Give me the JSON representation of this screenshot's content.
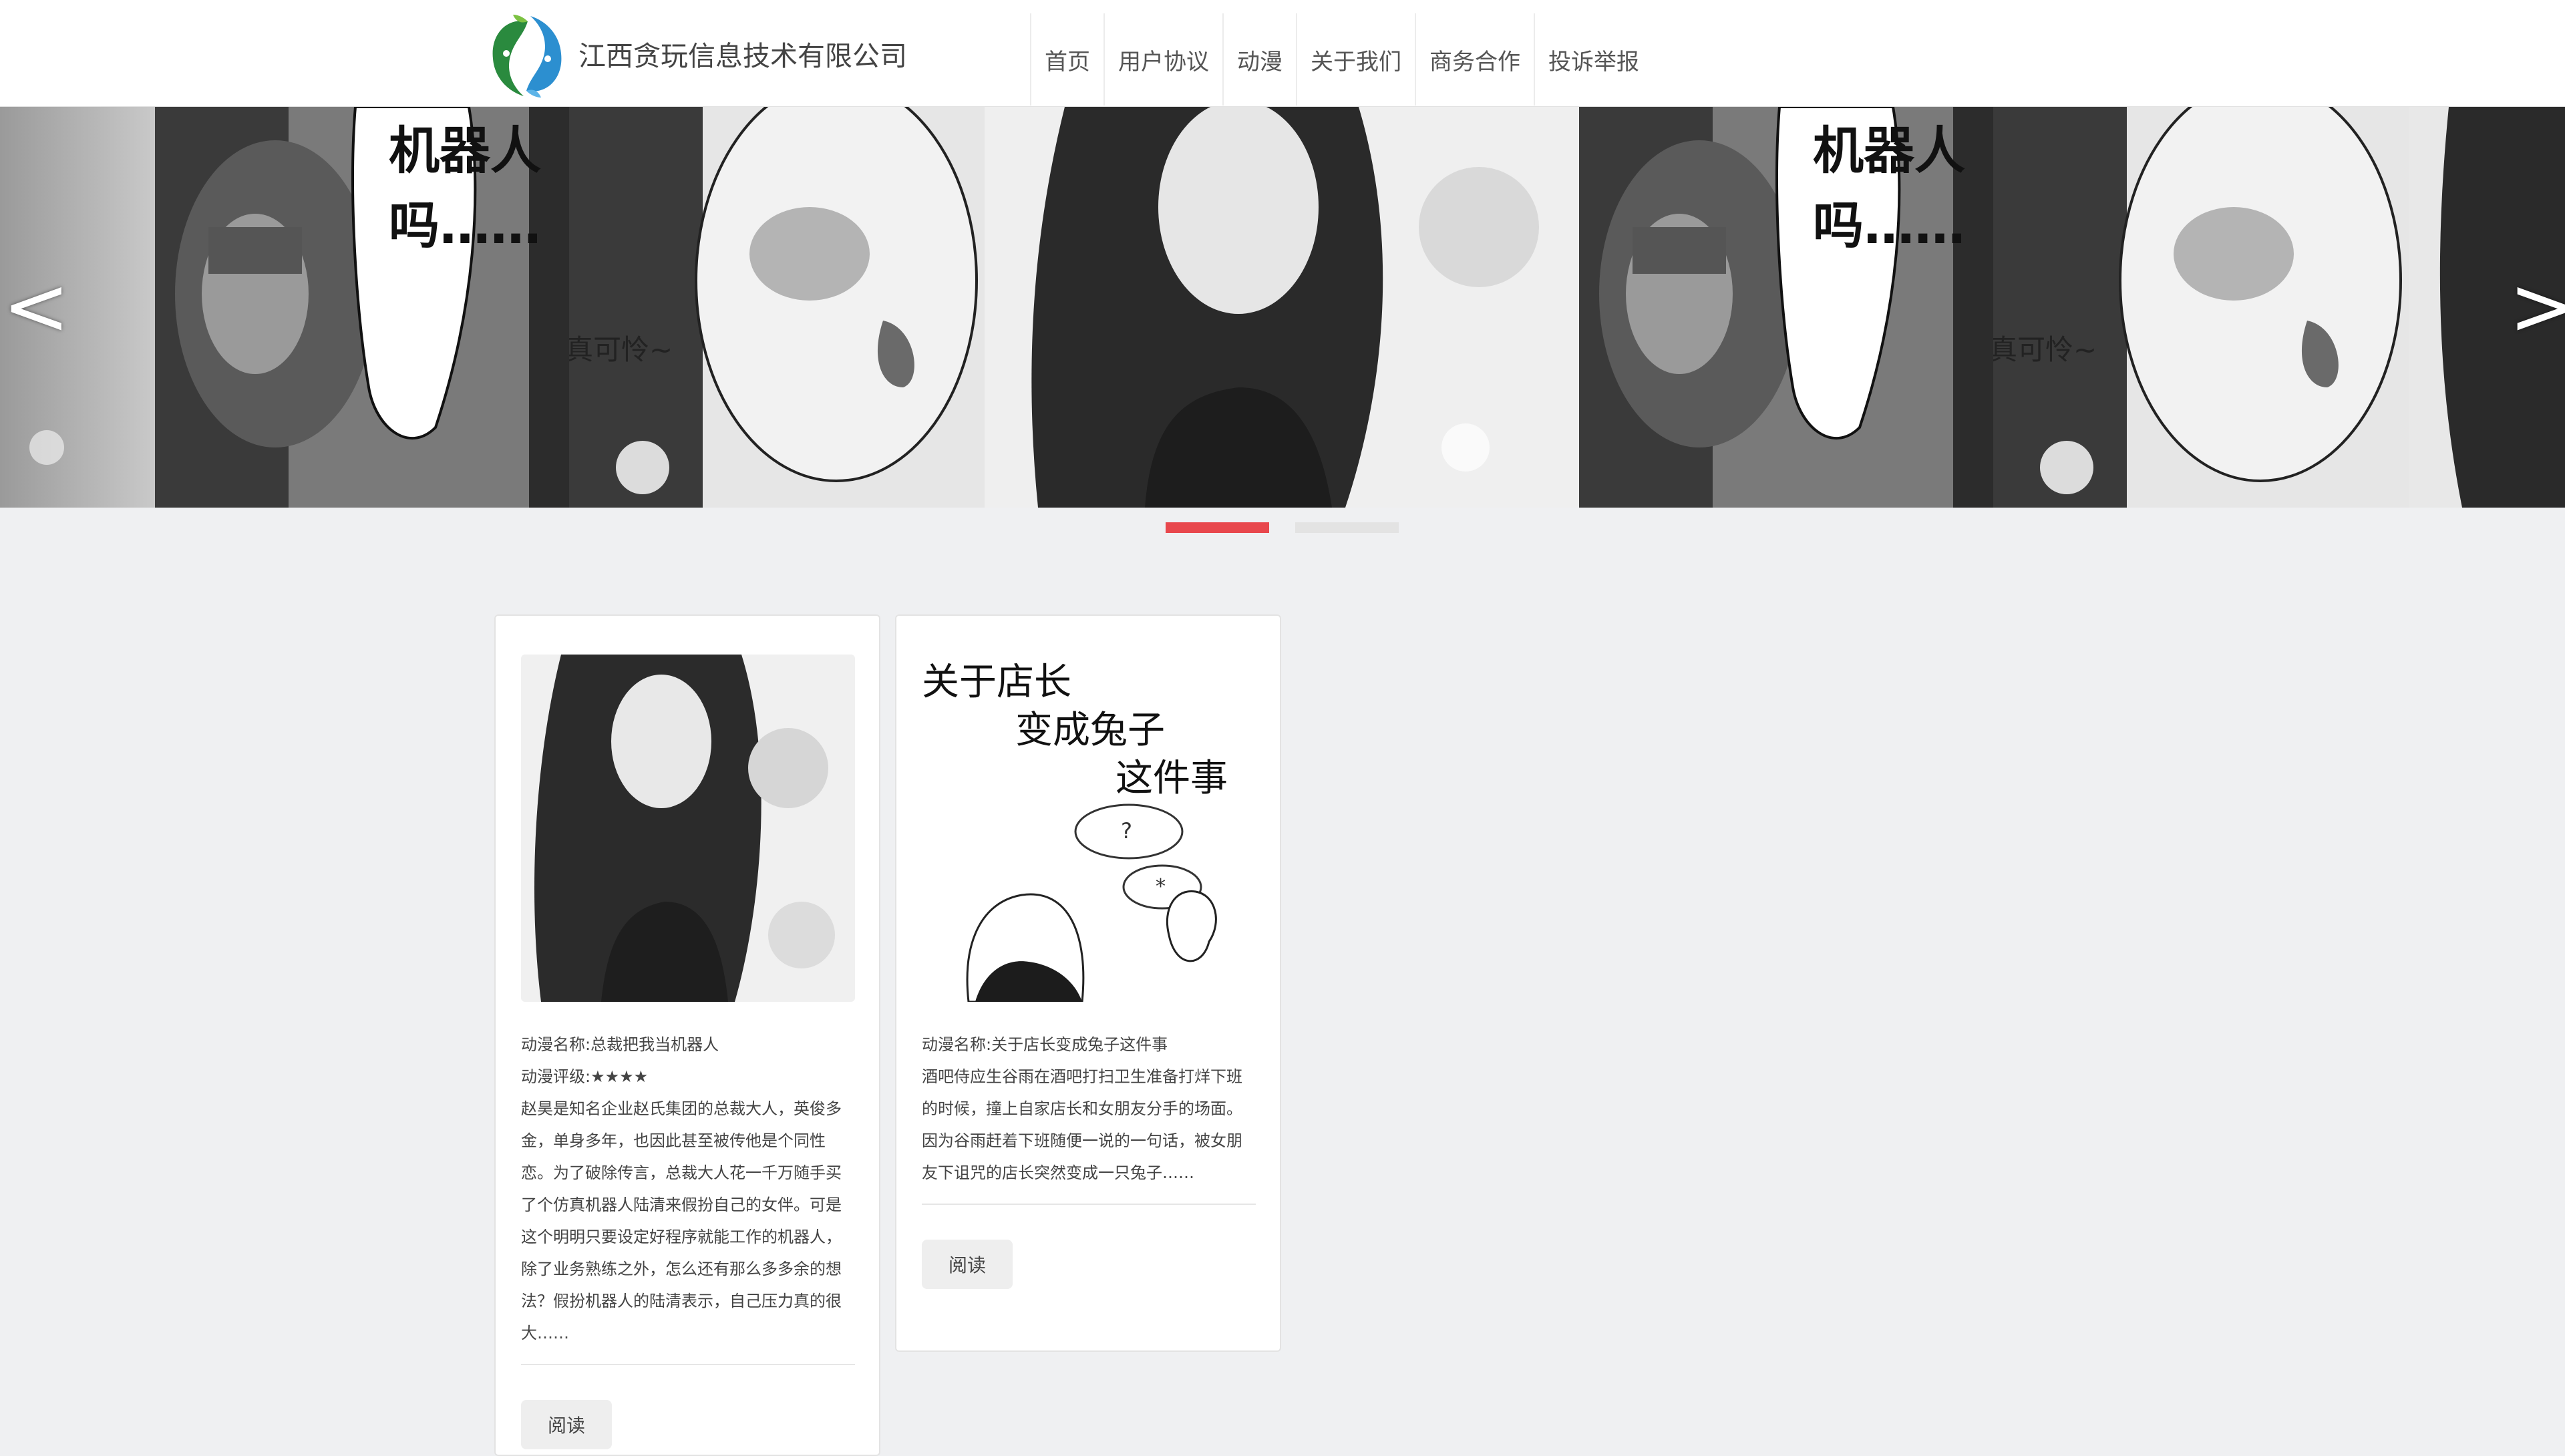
{
  "header": {
    "company_name": "江西贪玩信息技术有限公司",
    "nav": [
      "首页",
      "用户协议",
      "动漫",
      "关于我们",
      "商务合作",
      "投诉举报"
    ]
  },
  "carousel": {
    "prev_label": "<",
    "next_label": ">",
    "bubble_text_1": "机器人",
    "bubble_text_2": "吗……",
    "caption": "真可怜~",
    "active_index": 0,
    "slide_count": 2
  },
  "cards": [
    {
      "name_line": "动漫名称:总裁把我当机器人",
      "rating_line": "动漫评级:★★★★",
      "desc_lines": [
        "赵昊是知名企业赵氏集团的总裁大人，英俊多",
        "金，单身多年，也因此甚至被传他是个同性",
        "恋。为了破除传言，总裁大人花一千万随手买",
        "了个仿真机器人陆清来假扮自己的女伴。可是",
        "这个明明只要设定好程序就能工作的机器人，",
        "除了业务熟练之外，怎么还有那么多多余的想",
        "法？假扮机器人的陆清表示，自己压力真的很",
        "大……"
      ],
      "button": "阅读"
    },
    {
      "name_line": "动漫名称:关于店长变成兔子这件事",
      "cover_title": [
        "关于店长",
        "变成兔子",
        "这件事"
      ],
      "cover_bubble_1": "?",
      "cover_bubble_2": "*",
      "desc_lines": [
        "酒吧侍应生谷雨在酒吧打扫卫生准备打烊下班",
        "的时候，撞上自家店长和女朋友分手的场面。",
        "因为谷雨赶着下班随便一说的一句话，被女朋",
        "友下诅咒的店长突然变成一只兔子……"
      ],
      "button": "阅读"
    }
  ],
  "colors": {
    "accent": "#e8474d",
    "background": "#eff0f2",
    "logo_green": "#2a8a3e",
    "logo_blue": "#2c8fd0"
  },
  "icons": [
    "logo-fish-icon",
    "prev-arrow-icon",
    "next-arrow-icon"
  ]
}
